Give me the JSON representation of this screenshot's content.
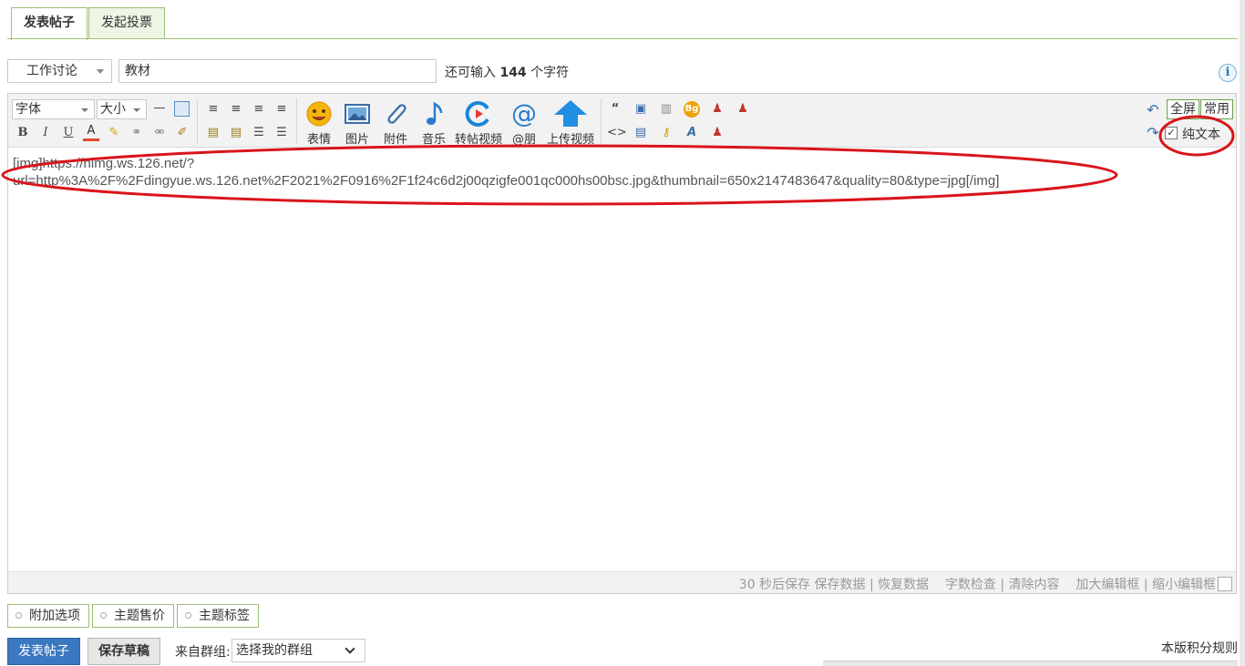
{
  "tabs": [
    {
      "label": "发表帖子",
      "active": true
    },
    {
      "label": "发起投票",
      "active": false
    }
  ],
  "post": {
    "type_label": "工作讨论",
    "subject_value": "教材",
    "remaining_prefix": "还可输入",
    "remaining_count": "144",
    "remaining_suffix": "个字符",
    "info_icon": "i"
  },
  "toolbar": {
    "font_label": "字体",
    "size_label": "大小",
    "buttons": {
      "emoji": "表情",
      "image": "图片",
      "attach": "附件",
      "music": "音乐",
      "repost_video": "转帖视频",
      "mention": "@朋",
      "upload_video": "上传视频"
    },
    "fullscreen": "全屏",
    "common": "常用",
    "plain_text": "纯文本",
    "plain_text_checked": true
  },
  "editor": {
    "content_line1": "[img]https://nimg.ws.126.net/?",
    "content_line2": "url=http%3A%2F%2Fdingyue.ws.126.net%2F2021%2F0916%2F1f24c6d2j00qzigfe001qc000hs00bsc.jpg&thumbnail=650x2147483647&quality=80&type=jpg[/img]",
    "status": {
      "autosave": "30 秒后保存",
      "save": "保存数据",
      "restore": "恢复数据",
      "wordcheck": "字数检查",
      "clear": "清除内容",
      "enlarge": "加大编辑框",
      "shrink": "缩小编辑框",
      "sep": "|"
    }
  },
  "options": [
    {
      "label": "附加选项"
    },
    {
      "label": "主题售价"
    },
    {
      "label": "主题标签"
    }
  ],
  "actions": {
    "submit": "发表帖子",
    "draft": "保存草稿",
    "group_label": "来自群组:",
    "group_select": "选择我的群组",
    "rules": "本版积分规则"
  },
  "colors": {
    "tab_border": "#9dbf74",
    "submit_blue": "#3a78c2",
    "annotation_red": "#d9141b"
  }
}
